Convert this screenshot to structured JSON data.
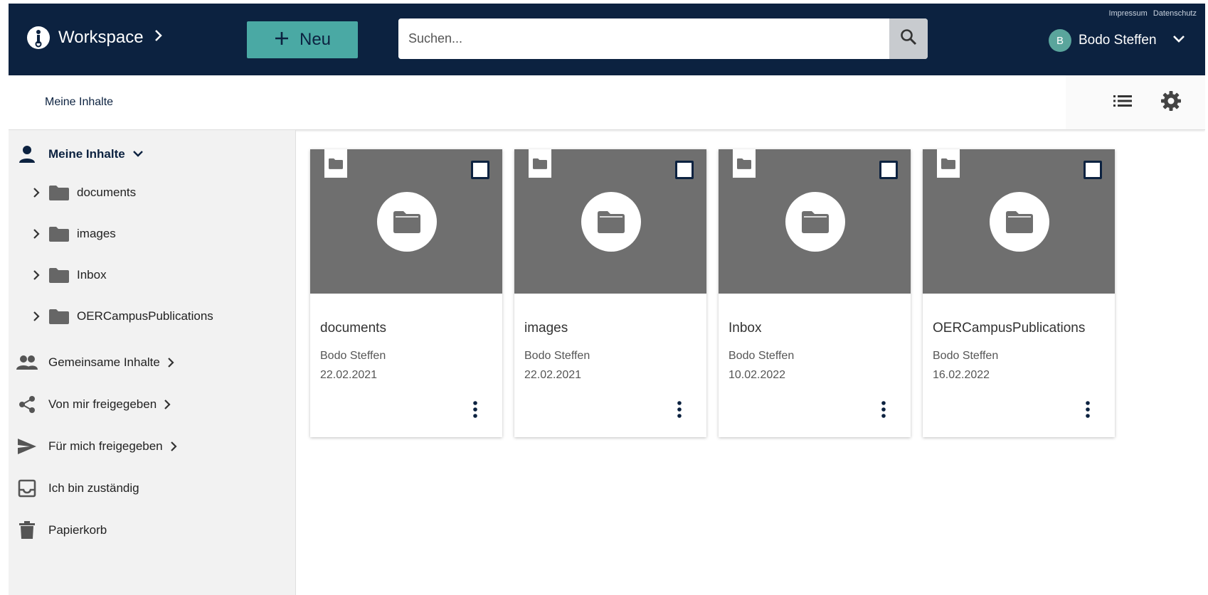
{
  "header": {
    "legal_links": [
      "Impressum",
      "Datenschutz"
    ],
    "brand_title": "Workspace",
    "new_button_label": "Neu",
    "search_placeholder": "Suchen...",
    "user": {
      "initial": "B",
      "name": "Bodo Steffen"
    }
  },
  "subheader": {
    "breadcrumb": "Meine Inhalte"
  },
  "sidebar": {
    "my_content": "Meine Inhalte",
    "tree": [
      {
        "label": "documents"
      },
      {
        "label": "images"
      },
      {
        "label": "Inbox"
      },
      {
        "label": "OERCampusPublications"
      }
    ],
    "shared_content": "Gemeinsame Inhalte",
    "shared_by_me": "Von mir freigegeben",
    "shared_with_me": "Für mich freigegeben",
    "responsible": "Ich bin zuständig",
    "trash": "Papierkorb"
  },
  "cards": [
    {
      "title": "documents",
      "owner": "Bodo Steffen",
      "date": "22.02.2021"
    },
    {
      "title": "images",
      "owner": "Bodo Steffen",
      "date": "22.02.2021"
    },
    {
      "title": "Inbox",
      "owner": "Bodo Steffen",
      "date": "10.02.2022"
    },
    {
      "title": "OERCampusPublications",
      "owner": "Bodo Steffen",
      "date": "16.02.2022"
    }
  ],
  "colors": {
    "header_bg": "#0c2240",
    "accent": "#4aa9a4",
    "thumb_bg": "#6f6f6f",
    "sidebar_bg": "#f2f2f2"
  },
  "icons": {
    "brand": "info-logo-icon",
    "search": "search-icon",
    "list_view": "list-view-icon",
    "settings": "gear-icon",
    "folder": "folder-icon",
    "more": "more-vertical-icon"
  }
}
